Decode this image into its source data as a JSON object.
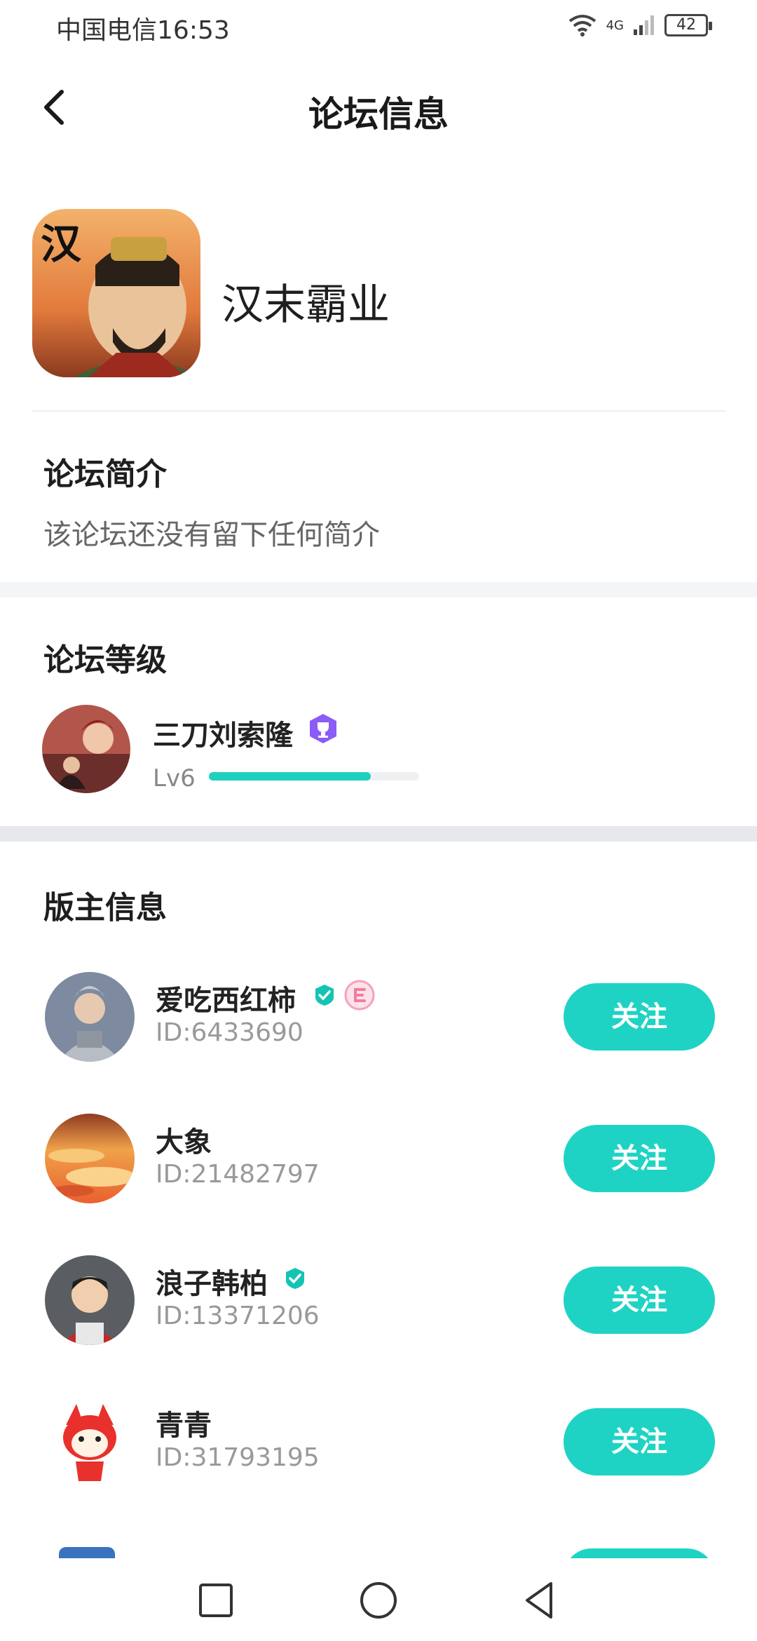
{
  "status_bar": {
    "carrier": "中国电信",
    "time": "16:53",
    "network": "4G",
    "battery": "42"
  },
  "header": {
    "title": "论坛信息",
    "back_icon": "chevron-left-icon"
  },
  "forum": {
    "name": "汉末霸业",
    "icon_char": "汉"
  },
  "intro": {
    "title": "论坛简介",
    "text": "该论坛还没有留下任何简介"
  },
  "level": {
    "title": "论坛等级",
    "user": "三刀刘索隆",
    "label": "Lv6",
    "progress": 0.77
  },
  "moderators": {
    "title": "版主信息",
    "items": [
      {
        "name": "爱吃西红柿",
        "id": "ID:6433690",
        "follow": "关注",
        "verified": true,
        "badge": "pink-e-badge"
      },
      {
        "name": "大象",
        "id": "ID:21482797",
        "follow": "关注"
      },
      {
        "name": "浪子韩柏",
        "id": "ID:13371206",
        "follow": "关注",
        "verified": true
      },
      {
        "name": "青青",
        "id": "ID:31793195",
        "follow": "关注"
      }
    ]
  },
  "colors": {
    "accent": "#1fd3c4",
    "badge_purple": "#8b5cf6",
    "verify": "#14c4b2"
  },
  "nav": {
    "icons": [
      "square-icon",
      "circle-icon",
      "triangle-back-icon"
    ]
  }
}
